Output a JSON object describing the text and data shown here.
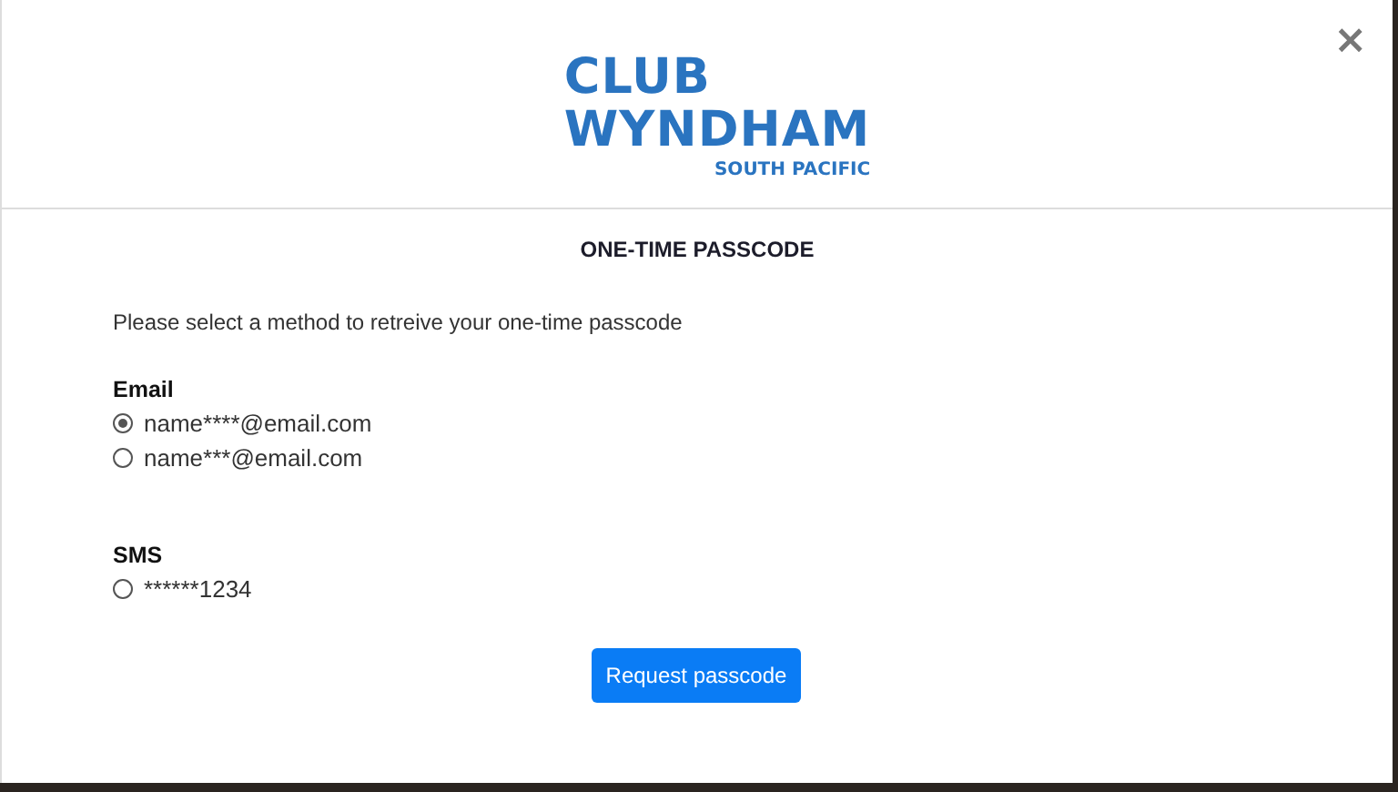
{
  "logo": {
    "lines": [
      "CLUB",
      "WYNDHAM"
    ],
    "tagline": "SOUTH PACIFIC"
  },
  "close": "×",
  "title": "ONE-TIME PASSCODE",
  "instruction": "Please select a method to retreive your one-time passcode",
  "groups": [
    {
      "label": "Email",
      "options": [
        {
          "text": "name****@email.com",
          "selected": true
        },
        {
          "text": "name***@email.com",
          "selected": false
        }
      ]
    },
    {
      "label": "SMS",
      "options": [
        {
          "text": "******1234",
          "selected": false
        }
      ]
    }
  ],
  "button": "Request passcode"
}
